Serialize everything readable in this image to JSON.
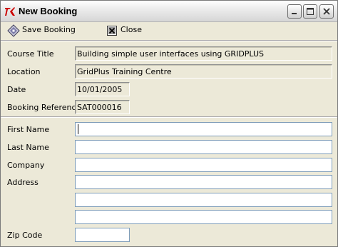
{
  "window": {
    "title": "New Booking",
    "controls": {
      "minimize": "minimize",
      "maximize": "maximize",
      "close": "close"
    }
  },
  "toolbar": {
    "save_label": "Save Booking",
    "save_icon": "save-diskette-icon",
    "close_label": "Close",
    "close_icon": "close-x-icon"
  },
  "booking": {
    "course_title": {
      "label": "Course Title",
      "value": "Building simple user interfaces using GRIDPLUS"
    },
    "location": {
      "label": "Location",
      "value": "GridPlus Training Centre"
    },
    "date": {
      "label": "Date",
      "value": "10/01/2005"
    },
    "reference": {
      "label": "Booking Reference",
      "value": "SAT000016"
    }
  },
  "attendee": {
    "first_name": {
      "label": "First Name",
      "value": ""
    },
    "last_name": {
      "label": "Last Name",
      "value": ""
    },
    "company": {
      "label": "Company",
      "value": ""
    },
    "address": {
      "label": "Address",
      "line1": "",
      "line2": "",
      "line3": ""
    },
    "zip_code": {
      "label": "Zip Code",
      "value": ""
    }
  },
  "colors": {
    "window_bg": "#ece9d8",
    "input_border": "#7f9db9",
    "title_icon_red": "#cc0000"
  }
}
